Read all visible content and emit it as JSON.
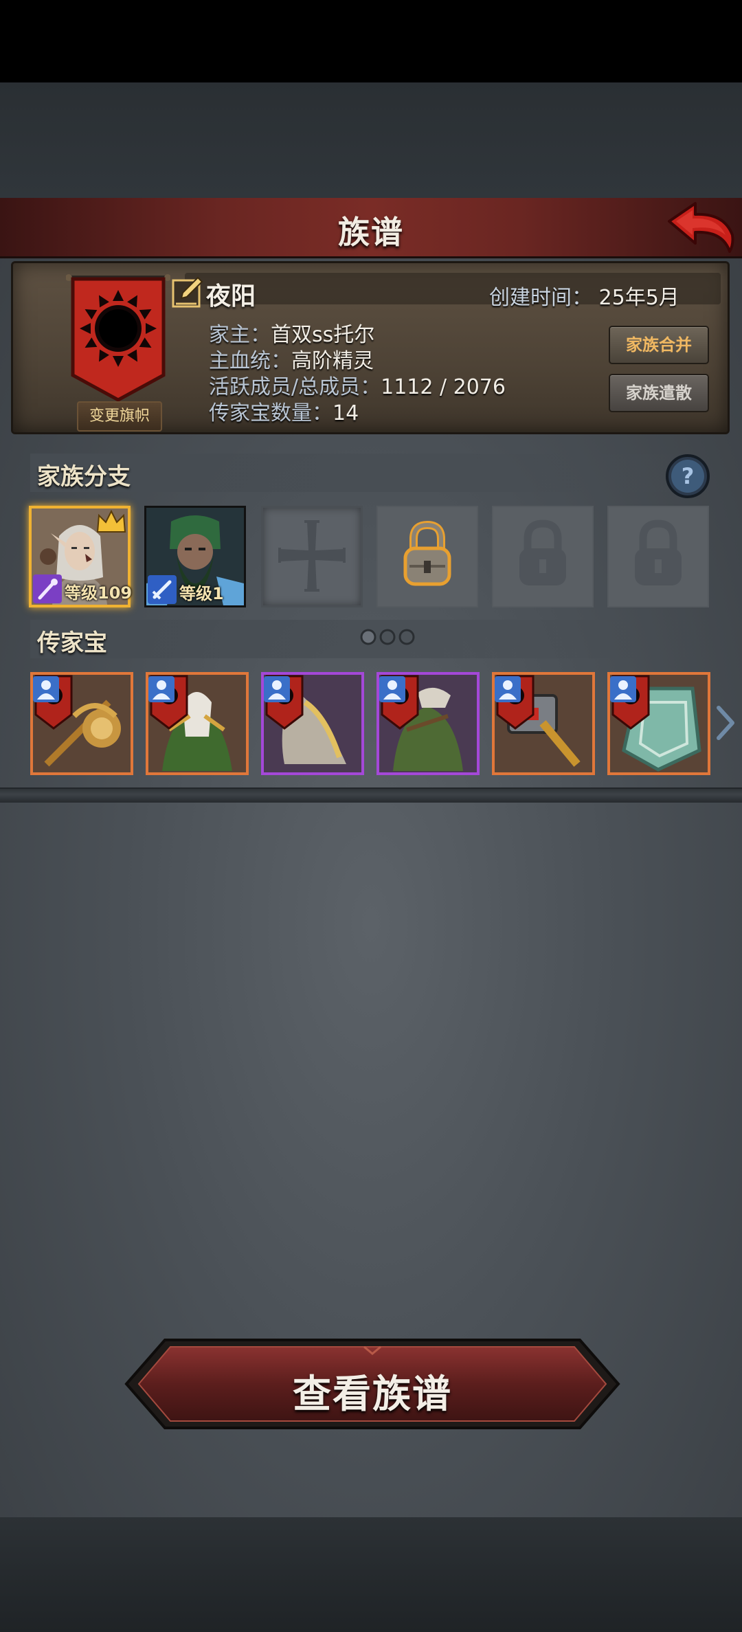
{
  "header": {
    "title": "族谱"
  },
  "family": {
    "name": "夜阳",
    "created_label": "创建时间：",
    "created_value": "25年5月",
    "change_banner_label": "变更旗帜",
    "leader_label": "家主：",
    "leader_value": "首双ss托尔",
    "bloodline_label": "主血统：",
    "bloodline_value": "高阶精灵",
    "members_label": "活跃成员/总成员：",
    "members_value": "1112 / 2076",
    "heirloom_count_label": "传家宝数量：",
    "heirloom_count_value": "14",
    "merge_label": "家族合并",
    "disband_label": "家族遣散",
    "banner_color": "#c0281e"
  },
  "branches": {
    "title": "家族分支",
    "members": [
      {
        "level_text": "等级109",
        "role": "mage",
        "leader": true
      },
      {
        "level_text": "等级1",
        "role": "warrior",
        "leader": false
      }
    ],
    "slots": [
      "add",
      "unlocked-lock",
      "locked",
      "locked"
    ]
  },
  "heirlooms": {
    "title": "传家宝",
    "pages": 3,
    "items": [
      {
        "icon": "golden-staff-icon",
        "rarity": "orange"
      },
      {
        "icon": "green-armor-icon",
        "rarity": "orange"
      },
      {
        "icon": "cloak-icon",
        "rarity": "purple"
      },
      {
        "icon": "green-tunic-icon",
        "rarity": "purple"
      },
      {
        "icon": "war-hammer-icon",
        "rarity": "orange"
      },
      {
        "icon": "jade-shield-icon",
        "rarity": "orange"
      }
    ]
  },
  "footer": {
    "view_button_label": "查看族谱"
  },
  "colors": {
    "title_bar": "#6a2622",
    "orange_rarity": "#e0773a",
    "purple_rarity": "#a448d8",
    "gold_frame": "#f0b232"
  }
}
